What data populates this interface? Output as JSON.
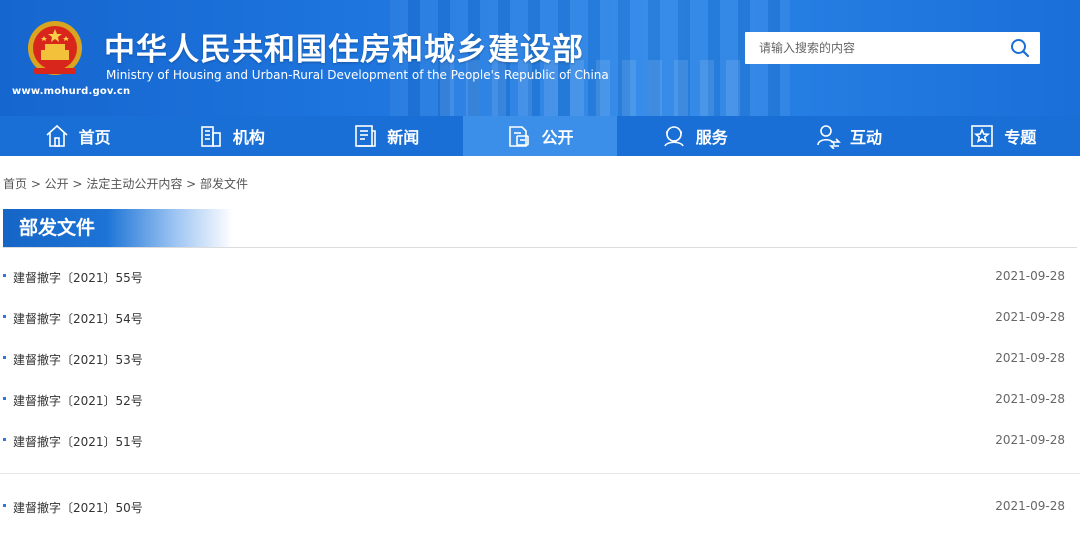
{
  "header": {
    "title": "中华人民共和国住房和城乡建设部",
    "subtitle": "Ministry of Housing and Urban-Rural Development of the People's Republic of China",
    "url": "www.mohurd.gov.cn",
    "emblem_icon": "national-emblem-icon"
  },
  "search": {
    "placeholder": "请输入搜索的内容",
    "icon": "search-icon"
  },
  "nav": {
    "items": [
      {
        "label": "首页",
        "icon": "home-icon"
      },
      {
        "label": "机构",
        "icon": "building-icon"
      },
      {
        "label": "新闻",
        "icon": "news-icon"
      },
      {
        "label": "公开",
        "icon": "document-icon",
        "active": true
      },
      {
        "label": "服务",
        "icon": "service-icon"
      },
      {
        "label": "互动",
        "icon": "interaction-icon"
      },
      {
        "label": "专题",
        "icon": "star-icon"
      }
    ]
  },
  "breadcrumb": "首页 > 公开 > 法定主动公开内容 > 部发文件",
  "section": {
    "title": "部发文件"
  },
  "list": {
    "items": [
      {
        "title": "建督撤字〔2021〕55号",
        "date": "2021-09-28"
      },
      {
        "title": "建督撤字〔2021〕54号",
        "date": "2021-09-28"
      },
      {
        "title": "建督撤字〔2021〕53号",
        "date": "2021-09-28"
      },
      {
        "title": "建督撤字〔2021〕52号",
        "date": "2021-09-28"
      },
      {
        "title": "建督撤字〔2021〕51号",
        "date": "2021-09-28"
      },
      {
        "title": "建督撤字〔2021〕50号",
        "date": "2021-09-28"
      }
    ]
  },
  "colors": {
    "header_blue": "#1a6fd6",
    "nav_active": "#3c8fe8",
    "bullet": "#2b7ad9"
  }
}
